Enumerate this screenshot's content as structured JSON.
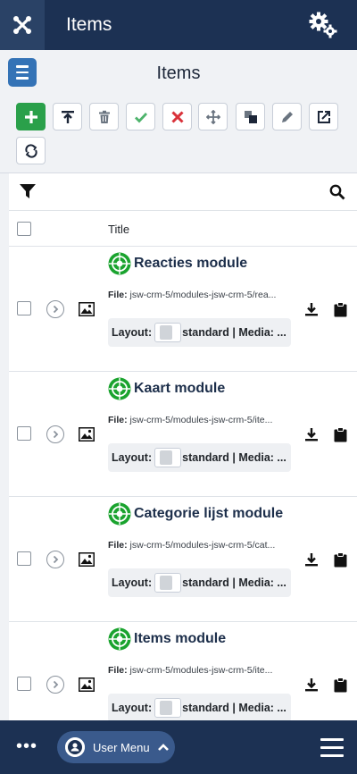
{
  "header": {
    "title": "Items"
  },
  "subheader": {
    "title": "Items"
  },
  "toolbar": {
    "buttons": [
      {
        "name": "new-button",
        "icon": "plus-icon"
      },
      {
        "name": "publish-top-button",
        "icon": "upload-top-icon"
      },
      {
        "name": "trash-button",
        "icon": "trash-icon"
      },
      {
        "name": "publish-button",
        "icon": "check-icon"
      },
      {
        "name": "unpublish-button",
        "icon": "x-icon"
      },
      {
        "name": "move-button",
        "icon": "move-icon"
      },
      {
        "name": "copy-button",
        "icon": "copy-icon"
      },
      {
        "name": "edit-button",
        "icon": "pencil-icon"
      },
      {
        "name": "export-button",
        "icon": "export-icon"
      },
      {
        "name": "refresh-button",
        "icon": "refresh-icon"
      }
    ]
  },
  "table": {
    "header_title": "Title",
    "file_label": "File:",
    "layout_label": "Layout:",
    "layout_value": "standard | Media: ...",
    "rows": [
      {
        "title": "Reacties module",
        "file": "jsw-crm-5/modules-jsw-crm-5/rea..."
      },
      {
        "title": "Kaart module",
        "file": "jsw-crm-5/modules-jsw-crm-5/ite..."
      },
      {
        "title": "Categorie lijst module",
        "file": "jsw-crm-5/modules-jsw-crm-5/cat..."
      },
      {
        "title": "Items module",
        "file": "jsw-crm-5/modules-jsw-crm-5/ite..."
      }
    ]
  },
  "bottombar": {
    "user_menu_label": "User Menu"
  },
  "colors": {
    "header_bg": "#1c3153",
    "accent_blue": "#3473b6",
    "green": "#2aa04a",
    "red": "#d9323a"
  }
}
